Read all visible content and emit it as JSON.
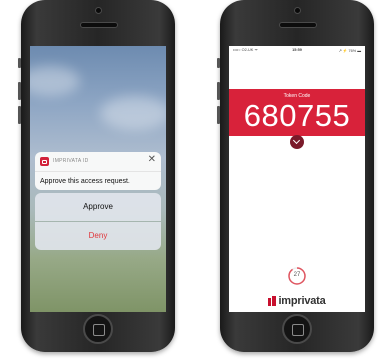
{
  "left_phone": {
    "notification": {
      "app_name": "IMPRIVATA ID",
      "close_symbol": "✕",
      "message": "Approve this access request."
    },
    "actions": {
      "approve_label": "Approve",
      "deny_label": "Deny"
    }
  },
  "right_phone": {
    "status_bar": {
      "carrier": "••••○ O2-UK ᯤ",
      "time": "15:59",
      "battery": "↗ ⚡ 76% ▬"
    },
    "token_label": "Token Code",
    "token_code": "680755",
    "countdown_seconds": "27",
    "countdown_fraction": 0.9,
    "brand": "imprivata"
  },
  "colors": {
    "brand_red": "#d8223a",
    "deny_red": "#e0353a"
  }
}
